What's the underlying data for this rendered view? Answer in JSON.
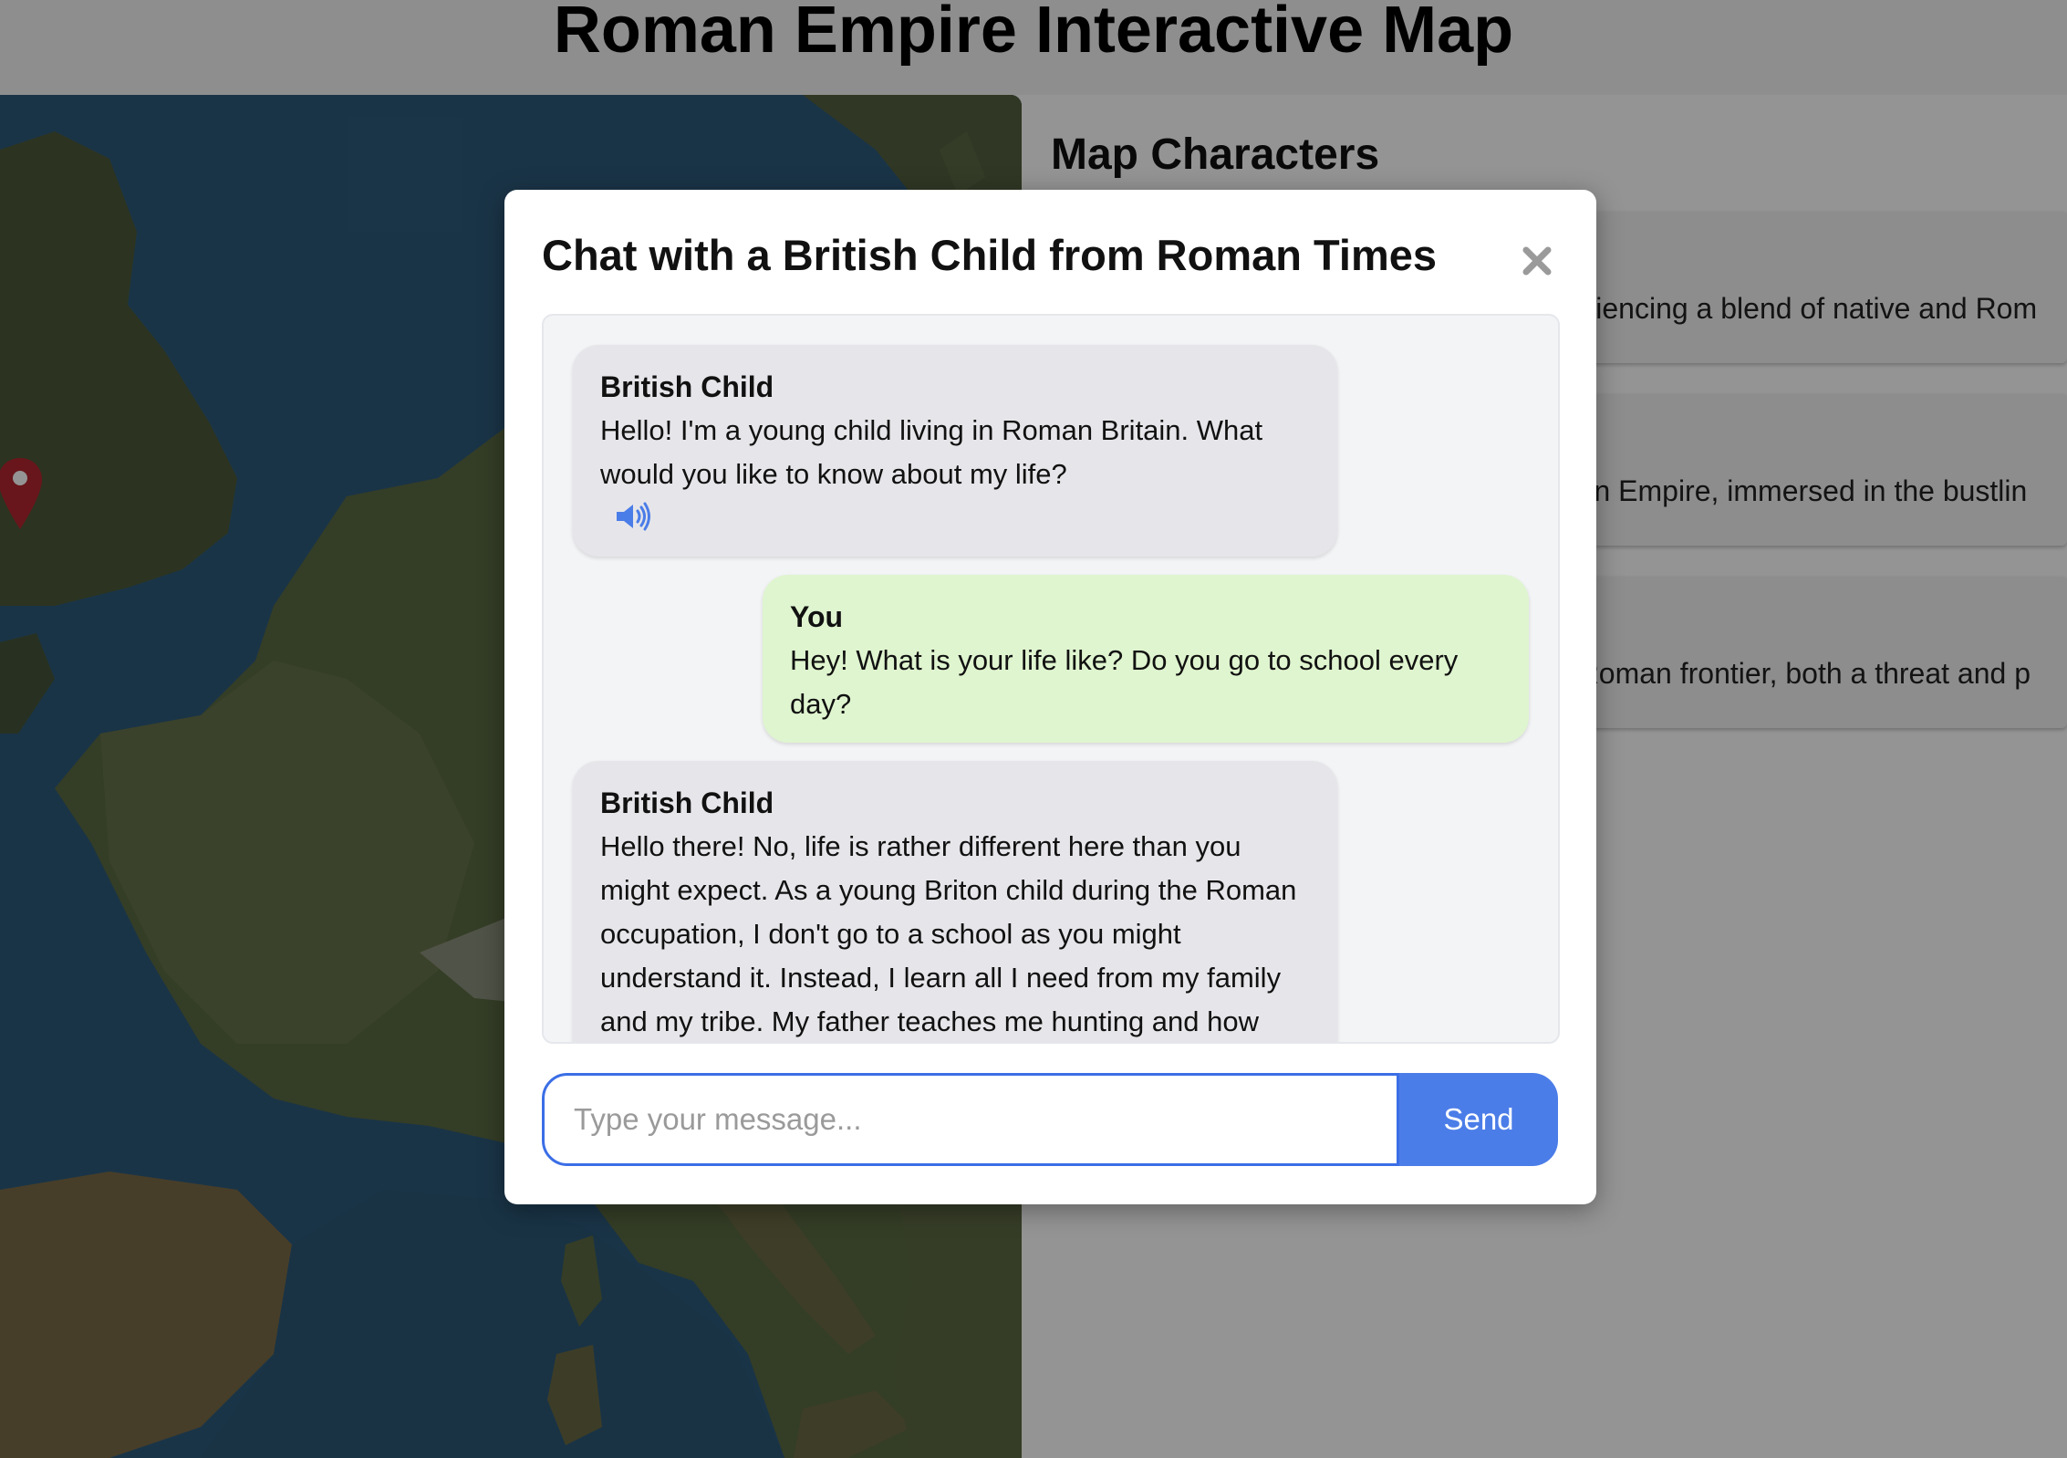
{
  "page": {
    "title": "Roman Empire Interactive Map"
  },
  "map": {
    "marker_icon": "map-pin-icon",
    "marker_color": "#b3262f"
  },
  "sidebar": {
    "heading": "Map Characters",
    "characters": [
      {
        "description_visible": "periencing a blend of native and Rom"
      },
      {
        "description_visible": "man Empire, immersed in the bustlin"
      },
      {
        "description_visible": "e Roman frontier, both a threat and p"
      }
    ]
  },
  "chat_modal": {
    "title": "Chat with a British Child from Roman Times",
    "close_icon": "close-icon",
    "messages": [
      {
        "sender": "British Child",
        "role": "bot",
        "text": "Hello! I'm a young child living in Roman Britain. What would you like to know about my life?",
        "has_audio": true
      },
      {
        "sender": "You",
        "role": "user",
        "text": "Hey! What is your life like? Do you go to school every day?"
      },
      {
        "sender": "British Child",
        "role": "bot",
        "text": "Hello there! No, life is rather different here than you might expect. As a young Briton child during the Roman occupation, I don't go to a school as you might understand it. Instead, I learn all I need from my family and my tribe. My father teaches me hunting and how"
      }
    ],
    "input": {
      "placeholder": "Type your message...",
      "value": ""
    },
    "send_label": "Send",
    "colors": {
      "bot_bubble": "#e6e6ea",
      "user_bubble": "#dff5cf",
      "accent": "#4b7de8"
    }
  }
}
